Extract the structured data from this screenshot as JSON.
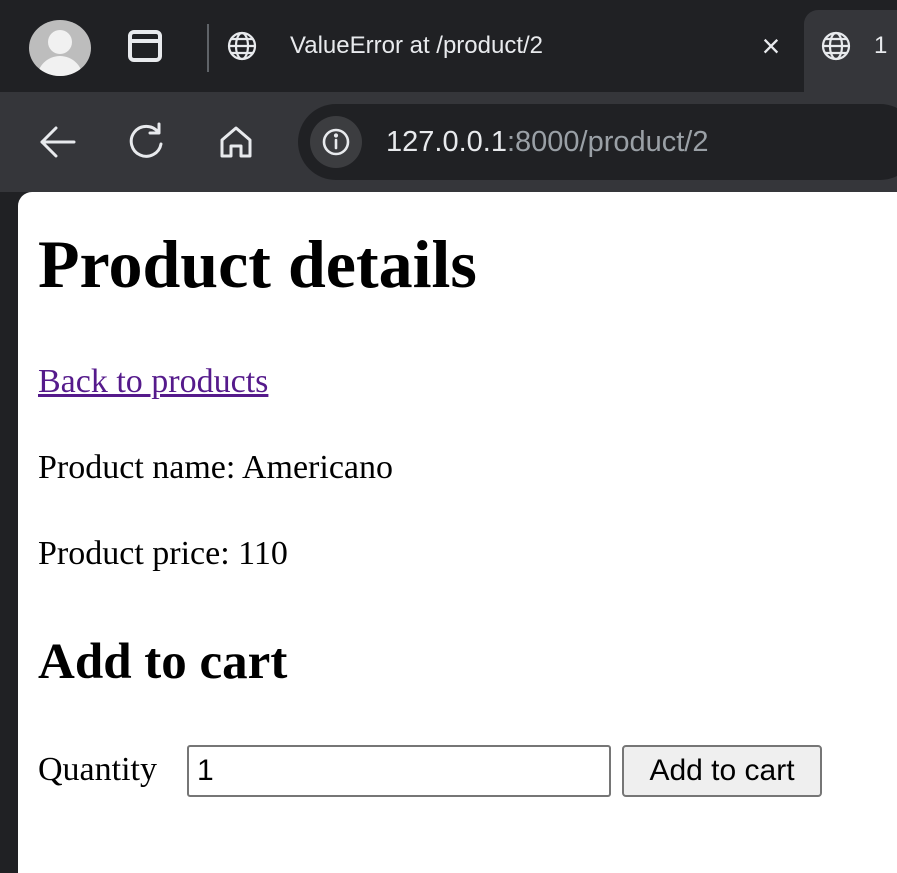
{
  "browser": {
    "tabs": [
      {
        "title": "ValueError at /product/2",
        "close_label": "×",
        "icon": "globe-icon"
      },
      {
        "title": "1",
        "icon": "globe-icon"
      }
    ],
    "url": {
      "host": "127.0.0.1",
      "rest": ":8000/product/2"
    },
    "icons": {
      "profile": "avatar-icon",
      "tab_search": "tab-search-icon",
      "back": "back-arrow-icon",
      "reload": "reload-icon",
      "home": "home-icon",
      "site_info": "info-icon"
    },
    "colors": {
      "tabstrip_bg": "#202124",
      "toolbar_bg": "#35363a",
      "text": "#e8eaed"
    }
  },
  "page": {
    "heading": "Product details",
    "back_link": "Back to products",
    "product_name": "Product name: Americano",
    "product_price": "Product price: 110",
    "cart_heading": "Add to cart",
    "form": {
      "quantity_label": "Quantity",
      "quantity_value": "1",
      "submit_label": "Add to cart"
    },
    "colors": {
      "visited_link": "#551a8b",
      "background": "#ffffff"
    }
  }
}
